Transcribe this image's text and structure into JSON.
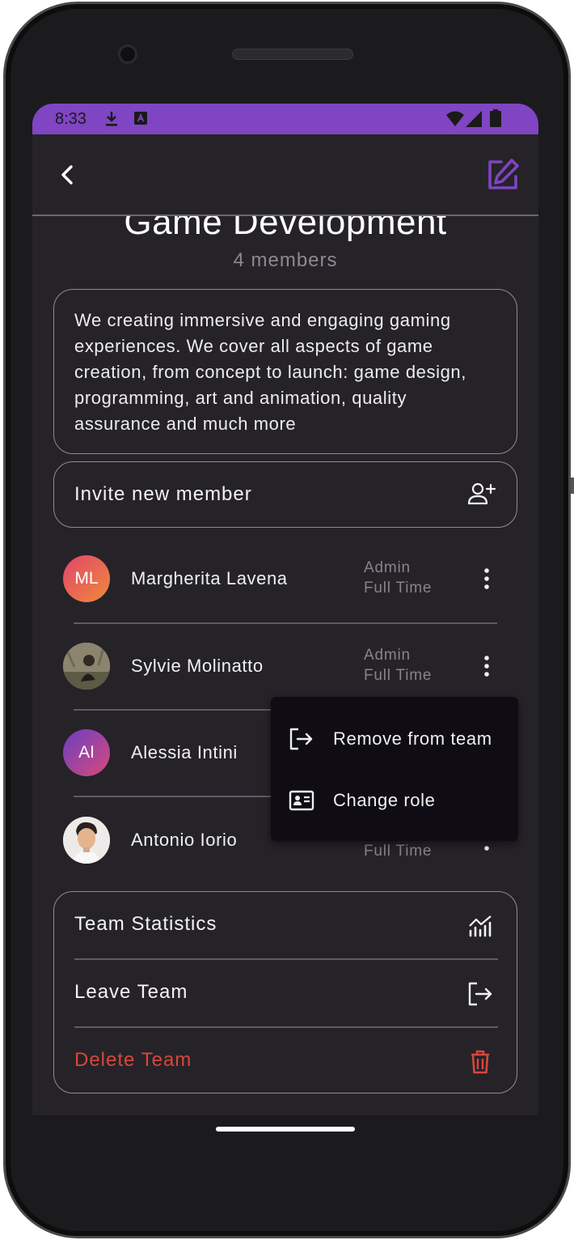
{
  "status_bar": {
    "time": "8:33"
  },
  "app_bar": {
    "back_icon": "arrow-back-icon",
    "edit_icon": "edit-square-icon",
    "accent_color": "#7f45c2"
  },
  "team": {
    "title": "Game Development",
    "members_count": "4 members",
    "description": "We creating immersive and engaging gaming experiences. We cover all aspects of game creation, from concept to launch: game design, programming, art and animation, quality assurance and much more"
  },
  "invite": {
    "label": "Invite new member",
    "icon": "person-add-icon"
  },
  "members": [
    {
      "initials": "ML",
      "name": "Margherita Lavena",
      "role": "Admin",
      "type": "Full Time",
      "avatar_color": "#e8703a"
    },
    {
      "initials": "",
      "name": "Sylvie Molinatto",
      "role": "Admin",
      "type": "Full Time",
      "avatar_color": "#6b6a56"
    },
    {
      "initials": "AI",
      "name": "Alessia Intini",
      "role": "",
      "type": "",
      "avatar_color": "#a23c8c"
    },
    {
      "initials": "",
      "name": "Antonio Iorio",
      "role": "",
      "type": "Full Time",
      "avatar_color": "#e6e2de"
    }
  ],
  "context_menu": {
    "items": [
      {
        "label": "Remove from team",
        "icon": "logout-icon"
      },
      {
        "label": "Change role",
        "icon": "id-card-icon"
      }
    ]
  },
  "actions": [
    {
      "label": "Team Statistics",
      "icon": "stats-chart-icon"
    },
    {
      "label": "Leave Team",
      "icon": "logout-icon"
    },
    {
      "label": "Delete Team",
      "icon": "trash-icon",
      "color": "#d9463a"
    }
  ]
}
